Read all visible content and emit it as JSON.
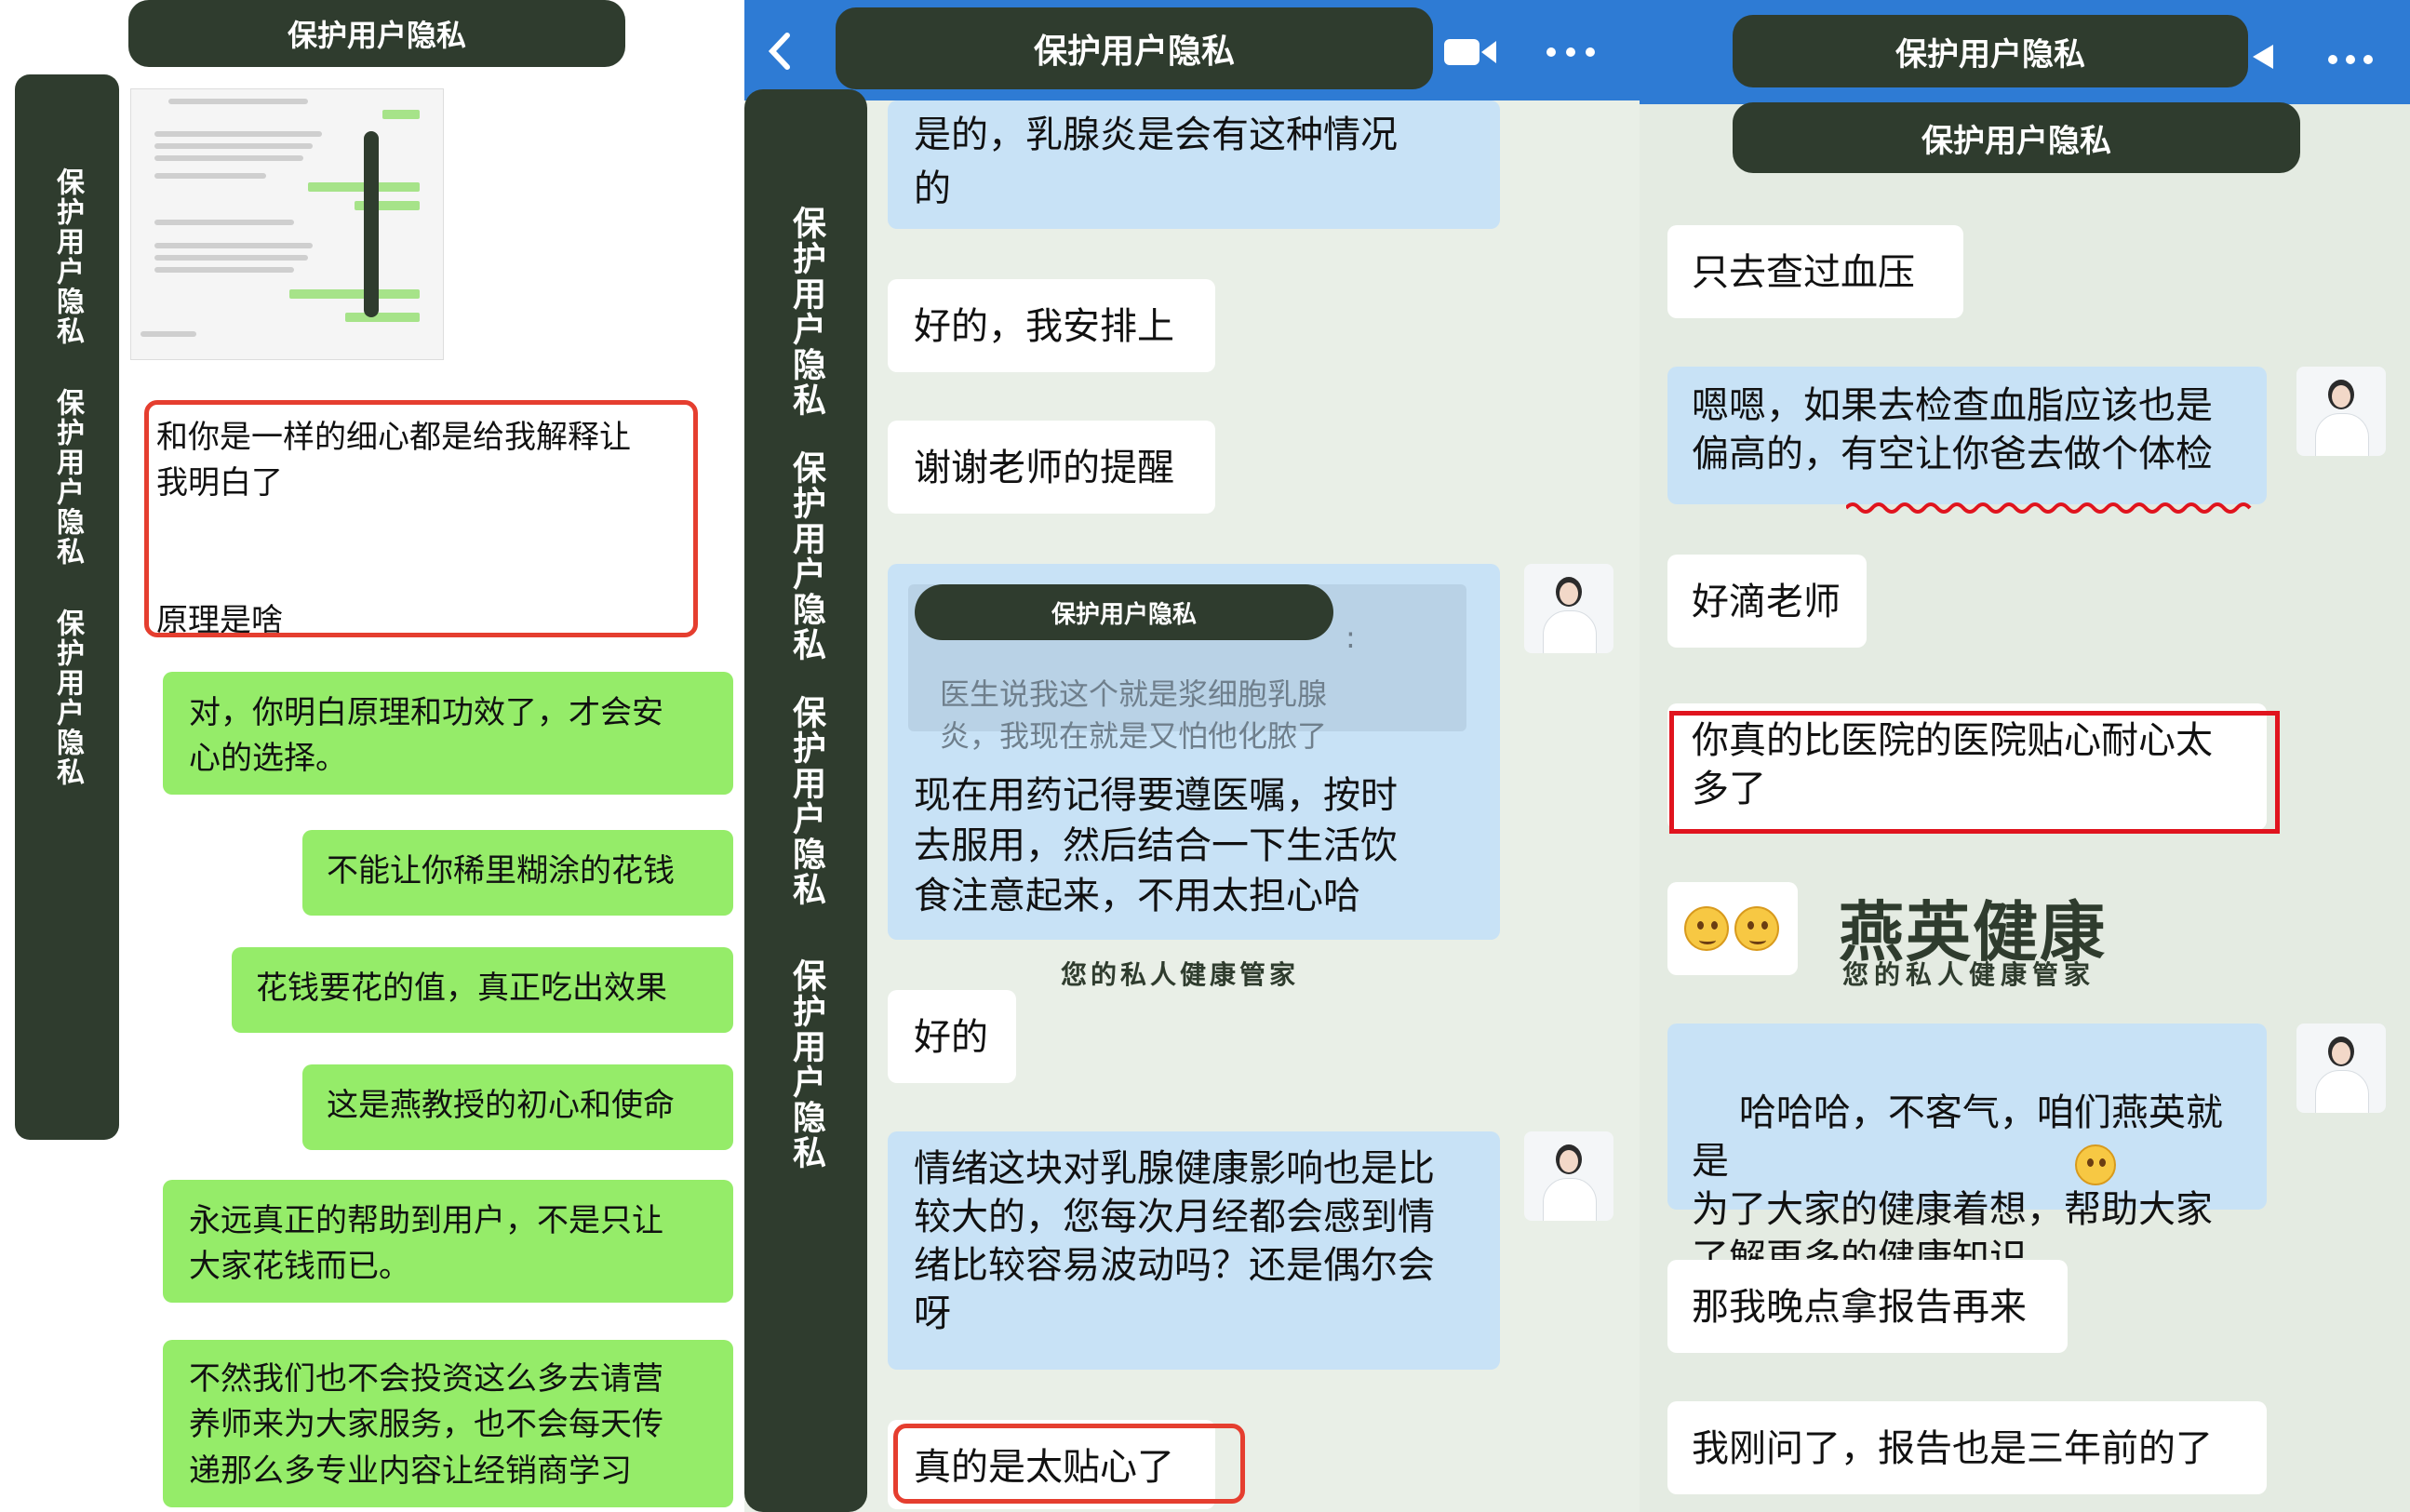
{
  "privacy_label": "保护用户隐私",
  "panel1": {
    "bubbles": [
      "和你是一样的细心都是给我解释让\n我明白了\n\n\n原理是啥",
      "对，你明白原理和功效了，才会安\n心的选择。",
      "不能让你稀里糊涂的花钱",
      "花钱要花的值，真正吃出效果",
      "这是燕教授的初心和使命",
      "永远真正的帮助到用户，不是只让\n大家花钱而已。",
      "不然我们也不会投资这么多去请营\n养师来为大家服务，也不会每天传\n递那么多专业内容让经销商学习"
    ]
  },
  "panel2": {
    "header_icons": [
      "back-icon",
      "video-call-icon",
      "more-icon"
    ],
    "bubbles": [
      "是的，乳腺炎是会有这种情况\n的",
      "好的，我安排上",
      "谢谢老师的提醒",
      "好的",
      "情绪这块对乳腺健康影响也是比\n较大的，您每次月经都会感到情\n绪比较容易波动吗？还是偶尔会\n呀",
      "真的是太贴心了"
    ],
    "quote_suffix": ":",
    "quote_text": "医生说我这个就是浆细胞乳腺\n炎，我现在就是又怕他化脓了",
    "quote_reply": "现在用药记得要遵医嘱，按时\n去服用，然后结合一下生活饮\n食注意起来，不用太担心哈",
    "watermark_sub": "您的私人健康管家"
  },
  "panel3": {
    "header_icons": [
      "video-call-icon",
      "more-icon"
    ],
    "bubbles": [
      "只去查过血压",
      "嗯嗯，如果去检查血脂应该也是\n偏高的，有空让你爸去做个体检",
      "好滴老师",
      "你真的比医院的医院贴心耐心太\n多了",
      "哈哈哈，不客气，咱们燕英就是\n为了大家的健康着想，帮助大家\n了解更多的健康知识",
      "那我晚点拿报告再来",
      "我刚问了，报告也是三年前的了"
    ],
    "logo_title": "燕英健康",
    "logo_subtitle": "您的私人健康管家"
  },
  "colors": {
    "privacy_bar": "#2f3c2e",
    "bubble_green": "#95ec69",
    "bubble_blue": "#c8e2f6",
    "highlight_red": "#e53e2f",
    "header_blue": "#2e7bd4"
  }
}
